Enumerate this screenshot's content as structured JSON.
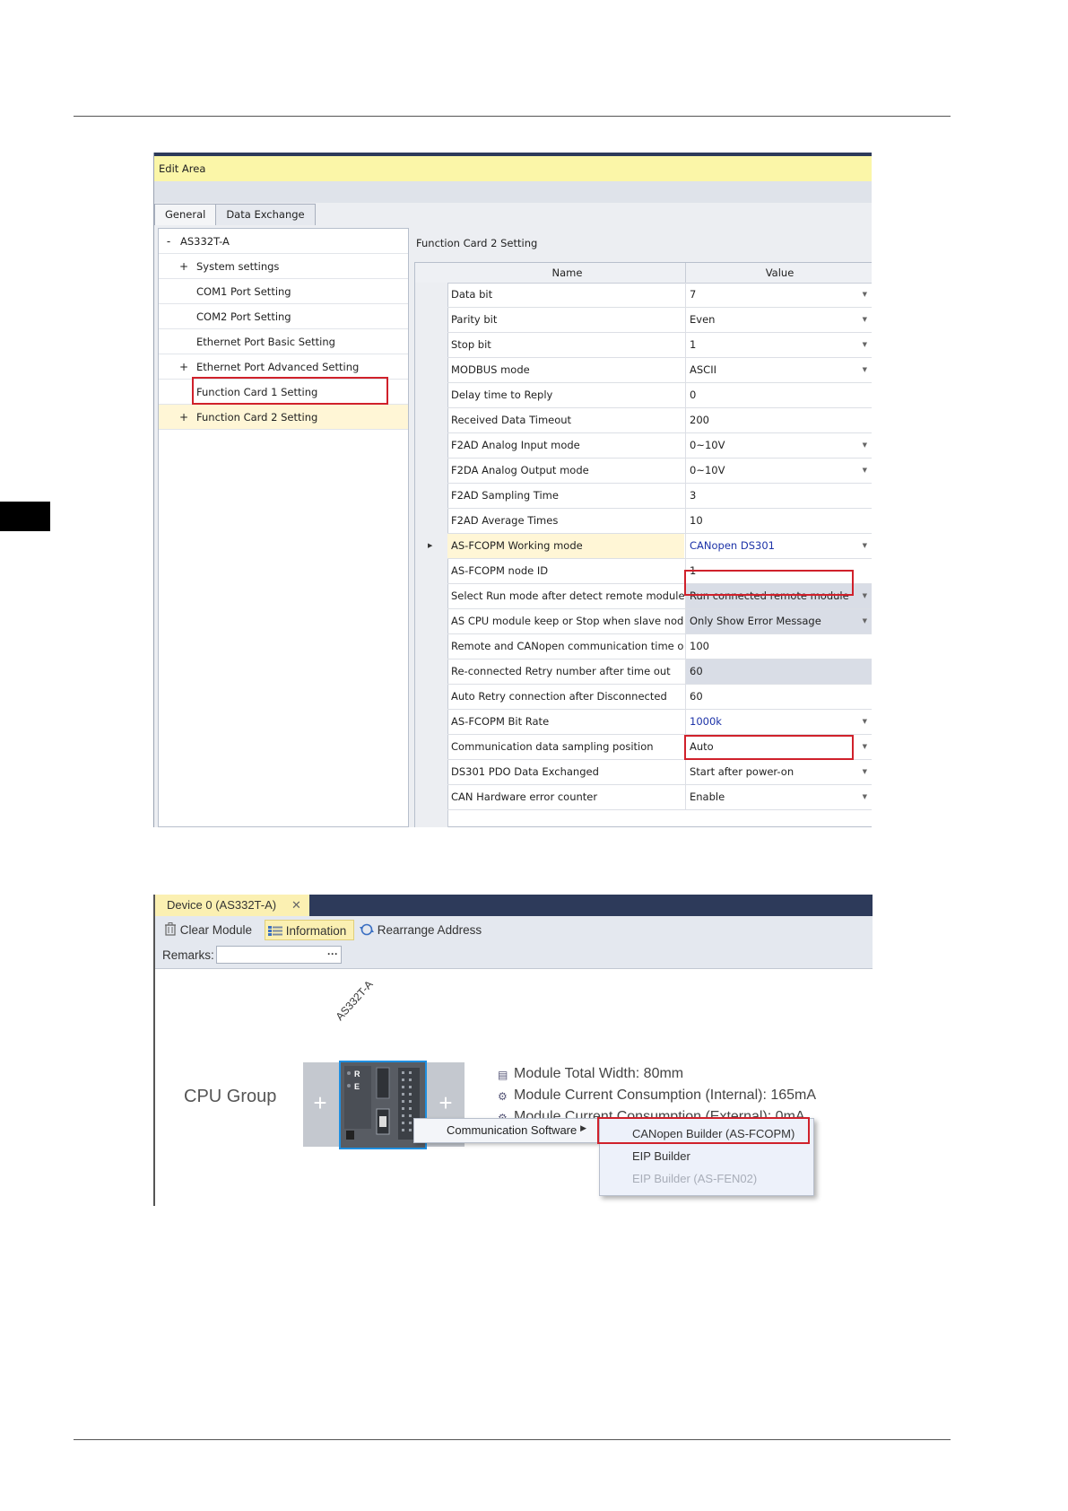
{
  "edit_area": {
    "title": "Edit Area",
    "tabs": [
      "General",
      "Data Exchange"
    ],
    "tree": {
      "root": "AS332T-A",
      "items": [
        {
          "label": "System settings",
          "expand": "+"
        },
        {
          "label": "COM1 Port Setting",
          "expand": ""
        },
        {
          "label": "COM2 Port Setting",
          "expand": ""
        },
        {
          "label": "Ethernet Port Basic Setting",
          "expand": ""
        },
        {
          "label": "Ethernet Port Advanced Setting",
          "expand": "+"
        },
        {
          "label": "Function Card 1 Setting",
          "expand": ""
        },
        {
          "label": "Function Card 2 Setting",
          "expand": "+"
        }
      ],
      "root_expand": "-"
    },
    "panel_title": "Function Card 2 Setting",
    "columns": [
      "Name",
      "Value"
    ],
    "rows": [
      {
        "name": "Data bit",
        "value": "7",
        "dropdown": true
      },
      {
        "name": "Parity bit",
        "value": "Even",
        "dropdown": true
      },
      {
        "name": "Stop bit",
        "value": "1",
        "dropdown": true
      },
      {
        "name": "MODBUS mode",
        "value": "ASCII",
        "dropdown": true
      },
      {
        "name": "Delay time to Reply",
        "value": "0",
        "dropdown": false
      },
      {
        "name": "Received Data Timeout",
        "value": "200",
        "dropdown": false
      },
      {
        "name": "F2AD Analog Input mode",
        "value": "0~10V",
        "dropdown": true
      },
      {
        "name": "F2DA Analog Output mode",
        "value": "0~10V",
        "dropdown": true
      },
      {
        "name": "F2AD Sampling Time",
        "value": "3",
        "dropdown": false
      },
      {
        "name": "F2AD Average Times",
        "value": "10",
        "dropdown": false
      },
      {
        "name": "AS-FCOPM Working mode",
        "value": "CANopen DS301",
        "dropdown": true
      },
      {
        "name": "AS-FCOPM node ID",
        "value": "1",
        "dropdown": false
      },
      {
        "name": "Select Run mode after detect remote module",
        "value": "Run connected remote module",
        "dropdown": true
      },
      {
        "name": "AS CPU module keep or Stop when slave node...",
        "value": "Only Show Error Message",
        "dropdown": true
      },
      {
        "name": "Remote and CANopen communication time out",
        "value": "100",
        "dropdown": false
      },
      {
        "name": "Re-connected Retry number after time out",
        "value": "60",
        "dropdown": false
      },
      {
        "name": "Auto Retry connection after Disconnected",
        "value": "60",
        "dropdown": false
      },
      {
        "name": "AS-FCOPM Bit Rate",
        "value": "1000k",
        "dropdown": true
      },
      {
        "name": "Communication data sampling position",
        "value": "Auto",
        "dropdown": true
      },
      {
        "name": "DS301 PDO Data Exchanged",
        "value": "Start after power-on",
        "dropdown": true
      },
      {
        "name": "CAN Hardware error counter",
        "value": "Enable",
        "dropdown": true
      }
    ]
  },
  "device": {
    "tab_title": "Device 0 (AS332T-A)",
    "close_glyph": "✕",
    "toolbar": {
      "clear_module": "Clear Module",
      "information": "Information",
      "rearrange": "Rearrange Address"
    },
    "remarks_label": "Remarks:",
    "remarks_value": "",
    "remarks_button": "···",
    "group_label": "CPU Group",
    "module_label": "AS332T-A",
    "module_leds": [
      "R",
      "E"
    ],
    "info": [
      "Module Total Width: 80mm",
      "Module Current Consumption (Internal): 165mA",
      "Module Current Consumption (External): 0mA"
    ],
    "context_menu": {
      "item": "Communication Software",
      "submenu": [
        {
          "label": "CANopen Builder (AS-FCOPM)",
          "enabled": true
        },
        {
          "label": "EIP Builder",
          "enabled": true
        },
        {
          "label": "EIP Builder (AS-FEN02)",
          "enabled": false
        }
      ]
    },
    "accent_color": "#1f8fe0",
    "highlight_color": "#d0212b"
  }
}
